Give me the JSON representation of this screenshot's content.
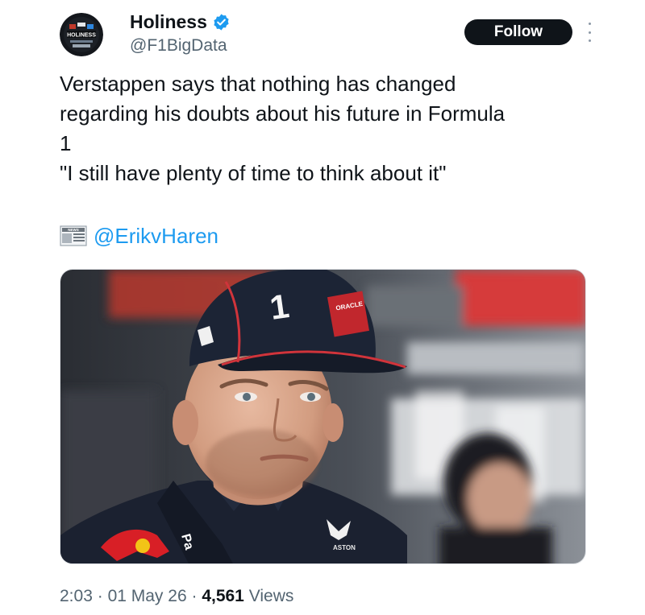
{
  "author": {
    "display_name": "Holiness",
    "handle": "@F1BigData",
    "avatar_text": "HOLINESS"
  },
  "follow_label": "Follow",
  "tweet": {
    "lines": [
      "Verstappen says that nothing has changed",
      "regarding his doubts about his future in Formula",
      "1",
      "\"I still have plenty of time to think about it\""
    ],
    "mention": "@ErikvHaren",
    "news_icon_text": "NEWS"
  },
  "media": {
    "cap_number": "1",
    "cap_brand": "ORACLE",
    "collar_text": "Pa",
    "shirt_logo": "ASTON"
  },
  "meta": {
    "time": "2:03",
    "separator": "·",
    "date": "01 May 26",
    "views_count": "4,561",
    "views_label": "Views"
  },
  "colors": {
    "accent": "#1d9bf0",
    "text": "#0f1419",
    "secondary": "#536471",
    "button_bg": "#0f1419"
  },
  "icons": {
    "verified": "verified-badge-icon",
    "more": "more-options-icon",
    "news": "newspaper-icon"
  }
}
